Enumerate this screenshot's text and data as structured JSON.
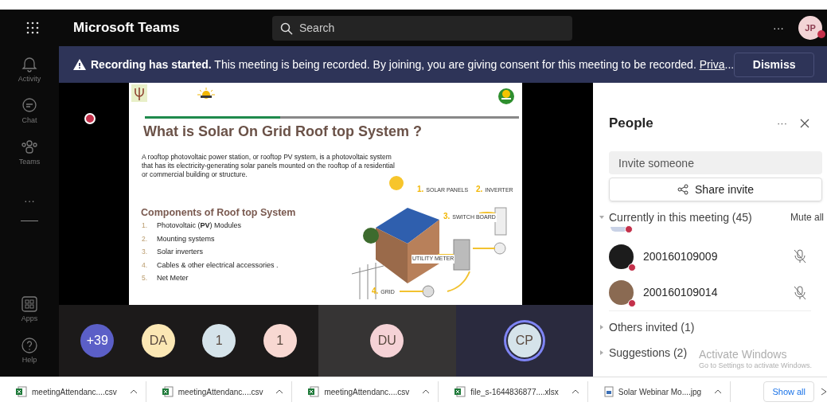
{
  "app": {
    "title": "Microsoft Teams",
    "search_placeholder": "Search",
    "more": "···",
    "user_initials": "JP"
  },
  "rail": [
    {
      "label": "Activity",
      "kind": "bell"
    },
    {
      "label": "Chat",
      "kind": "chat"
    },
    {
      "label": "Teams",
      "kind": "teams"
    },
    {
      "label": "···",
      "kind": "more"
    },
    {
      "label": "Apps",
      "kind": "apps"
    },
    {
      "label": "Help",
      "kind": "help"
    }
  ],
  "banner": {
    "text": "**Recording has started.** This meeting is being recorded. By joining, you are giving consent for this meeting to be recorded.",
    "link": "Priva",
    "ellipsis": "...",
    "button": "Dismiss"
  },
  "slide": {
    "title": "What is Solar On Grid Roof top System ?",
    "paragraph": "A rooftop photovoltaic power station, or rooftop PV system, is a photovoltaic system that has its electricity-generating solar panels mounted on the rooftop of a residential or commercial building or structure.",
    "subtitle": "Components of Roof top System",
    "items": [
      {
        "number": "1.",
        "text": "Photovoltaic (**PV**) Modules"
      },
      {
        "number": "2.",
        "text": "Mounting systems"
      },
      {
        "number": "3.",
        "text": "Solar inverters"
      },
      {
        "number": "4.",
        "text": "Cables & other electrical accessories ."
      },
      {
        "number": "5.",
        "text": "Net Meter"
      }
    ],
    "diagram_labels": [
      {
        "number": "1.",
        "text": "SOLAR PANELS"
      },
      {
        "number": "2.",
        "text": "INVERTER"
      },
      {
        "number": "3.",
        "text": "SWITCH BOARD"
      },
      {
        "text": "UTILITY METER"
      },
      {
        "number": "4.",
        "text": "GRID"
      }
    ]
  },
  "tiles": [
    {
      "kind": "group",
      "participants": [
        {
          "initials": "+39",
          "color": "#5b5fc7",
          "speaking": false
        },
        {
          "initials": "DA",
          "color": "#fbe7b4",
          "speaking": false
        },
        {
          "initials": "1",
          "color": "#d5e3ea",
          "speaking": false
        },
        {
          "initials": "1",
          "color": "#f8d8d2",
          "speaking": false
        }
      ]
    },
    {
      "kind": "single",
      "participants": [
        {
          "initials": "DU",
          "color": "#f5d2d6",
          "speaking": false
        }
      ]
    },
    {
      "kind": "single",
      "participants": [
        {
          "initials": "CP",
          "color": "#d5e3ea",
          "speaking": true
        }
      ]
    }
  ],
  "people": {
    "title": "People",
    "more": "···",
    "invite_placeholder": "Invite someone",
    "share": "Share invite",
    "sections": [
      {
        "label": "Currently in this meeting (45)",
        "expanded": true,
        "action": "Mute all",
        "members": [
          {
            "name": "200160109009",
            "muted": true
          },
          {
            "name": "200160109014",
            "muted": true
          }
        ]
      },
      {
        "label": "Others invited (1)",
        "expanded": false
      },
      {
        "label": "Suggestions (2)",
        "expanded": false
      }
    ]
  },
  "os_notice": {
    "title": "Activate Windows",
    "text": "Go to Settings to activate Windows."
  },
  "downloads": [
    {
      "name": "meetingAttendanc....csv",
      "kind": "excel"
    },
    {
      "name": "meetingAttendanc....csv",
      "kind": "excel"
    },
    {
      "name": "meetingAttendanc....csv",
      "kind": "excel"
    },
    {
      "name": "file_s-1644836877....xlsx",
      "kind": "excel"
    },
    {
      "name": "Solar Webinar Mo....jpg",
      "kind": "image"
    }
  ],
  "show_all": "Show all"
}
